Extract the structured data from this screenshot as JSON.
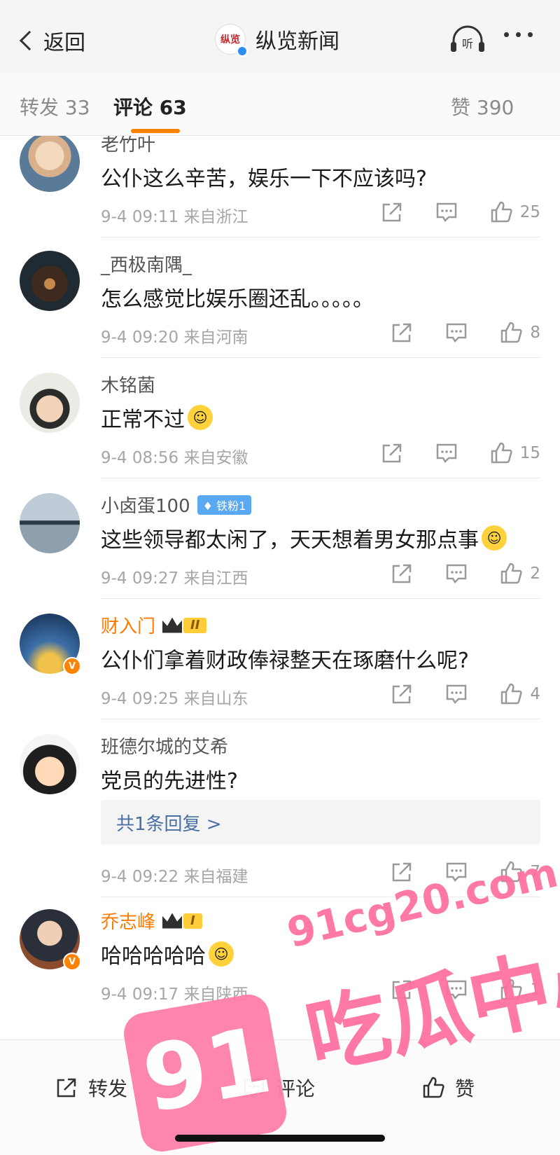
{
  "header": {
    "back_label": "返回",
    "brand_logo_text": "纵览",
    "brand_name": "纵览新闻",
    "listen_label": "听"
  },
  "tabs": [
    {
      "label": "转发",
      "count": "33"
    },
    {
      "label": "评论",
      "count": "63"
    },
    {
      "label": "赞",
      "count": "390"
    }
  ],
  "comments": [
    {
      "name": "老竹叶",
      "text": "公仆这么辛苦，娱乐一下不应该吗?",
      "time": "9-4 09:11",
      "location": "来自浙江",
      "likes": "25"
    },
    {
      "name": "_西极南隅_",
      "text": "怎么感觉比娱乐圈还乱。。。。。",
      "time": "9-4 09:20",
      "location": "来自河南",
      "likes": "8"
    },
    {
      "name": "木铭菌",
      "text": "正常不过",
      "time": "9-4 08:56",
      "location": "来自安徽",
      "likes": "15"
    },
    {
      "name": "小卤蛋100",
      "badge": "铁粉1",
      "text": "这些领导都太闲了，天天想着男女那点事",
      "time": "9-4 09:27",
      "location": "来自江西",
      "likes": "2"
    },
    {
      "name": "财入门",
      "level": "II",
      "text": "公仆们拿着财政俸禄整天在琢磨什么呢?",
      "time": "9-4 09:25",
      "location": "来自山东",
      "likes": "4"
    },
    {
      "name": "班德尔城的艾希",
      "text": "党员的先进性?",
      "reply": "共1条回复 >",
      "time": "9-4 09:22",
      "location": "来自福建",
      "likes": "7"
    },
    {
      "name": "乔志峰",
      "level": "I",
      "text": "哈哈哈哈哈",
      "time": "9-4 09:17",
      "location": "来自陕西",
      "likes": "1"
    }
  ],
  "bottom_bar": {
    "repost_label": "转发",
    "comment_label": "评论",
    "like_label": "赞"
  },
  "watermark": {
    "url": "91cg20.com",
    "logo": "91",
    "text": "吃瓜中心"
  },
  "colors": {
    "accent": "#ff8200",
    "verified": "#2d8ef5",
    "watermark": "#ff6ea0",
    "reply_link": "#4a6fa5"
  }
}
